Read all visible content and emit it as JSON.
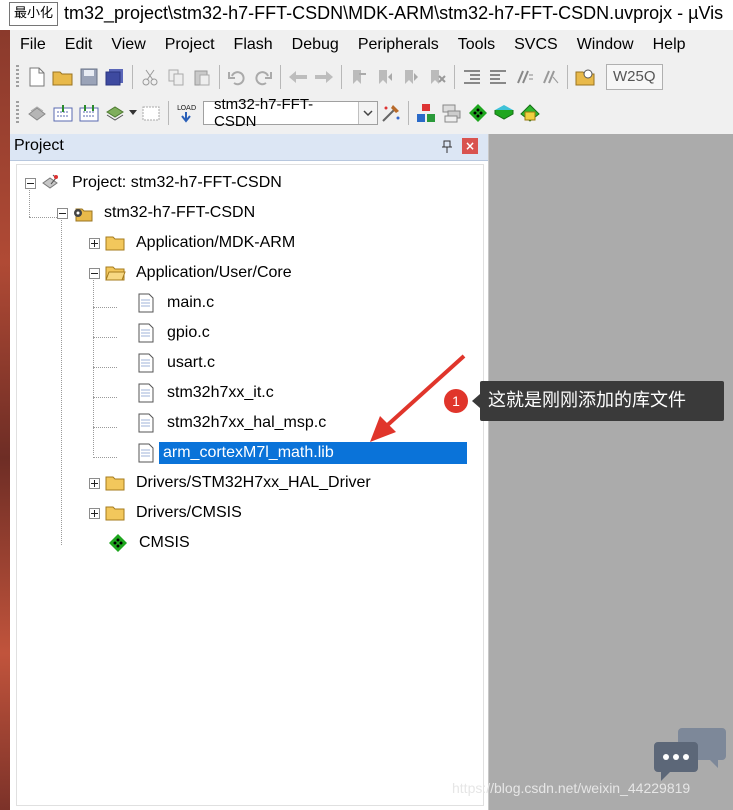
{
  "window": {
    "title": "tm32_project\\stm32-h7-FFT-CSDN\\MDK-ARM\\stm32-h7-FFT-CSDN.uvprojx - µVis",
    "minimize_tooltip": "最小化"
  },
  "menu": [
    {
      "label": "File"
    },
    {
      "label": "Edit"
    },
    {
      "label": "View"
    },
    {
      "label": "Project"
    },
    {
      "label": "Flash"
    },
    {
      "label": "Debug"
    },
    {
      "label": "Peripherals"
    },
    {
      "label": "Tools"
    },
    {
      "label": "SVCS"
    },
    {
      "label": "Window"
    },
    {
      "label": "Help"
    }
  ],
  "toolbar": {
    "target_name": "stm32-h7-FFT-CSDN",
    "partial_box": "W25Q",
    "load_icon_text": "LOAD"
  },
  "panel": {
    "title": "Project",
    "close_glyph": "×"
  },
  "tree": [
    {
      "label": "Project: stm32-h7-FFT-CSDN"
    },
    {
      "label": "stm32-h7-FFT-CSDN"
    },
    {
      "label": "Application/MDK-ARM"
    },
    {
      "label": "Application/User/Core"
    },
    {
      "label": "main.c"
    },
    {
      "label": "gpio.c"
    },
    {
      "label": "usart.c"
    },
    {
      "label": "stm32h7xx_it.c"
    },
    {
      "label": "stm32h7xx_hal_msp.c"
    },
    {
      "label": "arm_cortexM7l_math.lib"
    },
    {
      "label": "Drivers/STM32H7xx_HAL_Driver"
    },
    {
      "label": "Drivers/CMSIS"
    },
    {
      "label": "CMSIS"
    }
  ],
  "annotation": {
    "badge": "1",
    "text": "这就是刚刚添加的库文件"
  },
  "watermark": "https://blog.csdn.net/weixin_44229819",
  "colors": {
    "selection": "#0a73d9",
    "panel_header": "#dce6f4",
    "editor_bg": "#ababab",
    "annotation_red": "#e0352b"
  }
}
